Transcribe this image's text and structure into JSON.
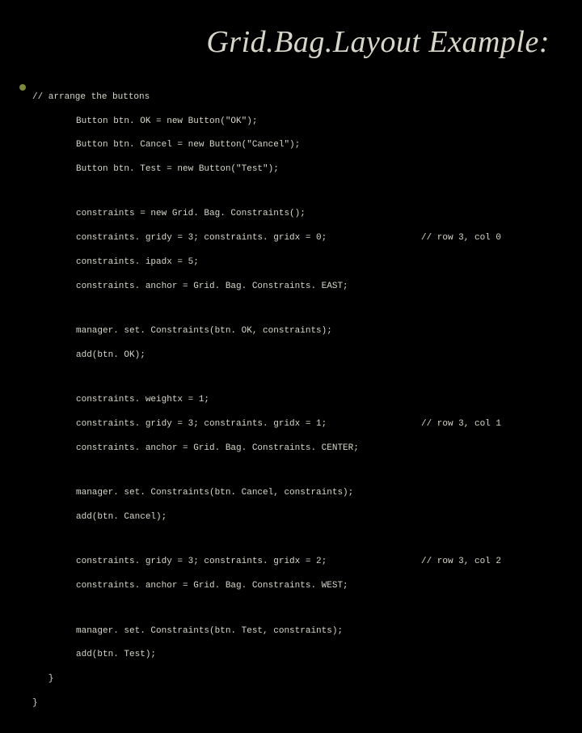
{
  "title": "Grid.Bag.Layout Example:",
  "code": {
    "c0": "// arrange the buttons",
    "c1": "Button btn. OK = new Button(\"OK\");",
    "c2": "Button btn. Cancel = new Button(\"Cancel\");",
    "c3": "Button btn. Test = new Button(\"Test\");",
    "c4": "constraints = new Grid. Bag. Constraints();",
    "c5": "constraints. gridy = 3; constraints. gridx = 0;",
    "c5r": "// row 3, col 0",
    "c6": "constraints. ipadx = 5;",
    "c7": "constraints. anchor = Grid. Bag. Constraints. EAST;",
    "c8": "manager. set. Constraints(btn. OK, constraints);",
    "c9": "add(btn. OK);",
    "c10": "constraints. weightx = 1;",
    "c11": "constraints. gridy = 3; constraints. gridx = 1;",
    "c11r": "// row 3, col 1",
    "c12": "constraints. anchor = Grid. Bag. Constraints. CENTER;",
    "c13": "manager. set. Constraints(btn. Cancel, constraints);",
    "c14": "add(btn. Cancel);",
    "c15": "constraints. gridy = 3; constraints. gridx = 2;",
    "c15r": "// row 3, col 2",
    "c16": "constraints. anchor = Grid. Bag. Constraints. WEST;",
    "c17": "manager. set. Constraints(btn. Test, constraints);",
    "c18": "add(btn. Test);",
    "c19": "   }",
    "c20": "}"
  }
}
